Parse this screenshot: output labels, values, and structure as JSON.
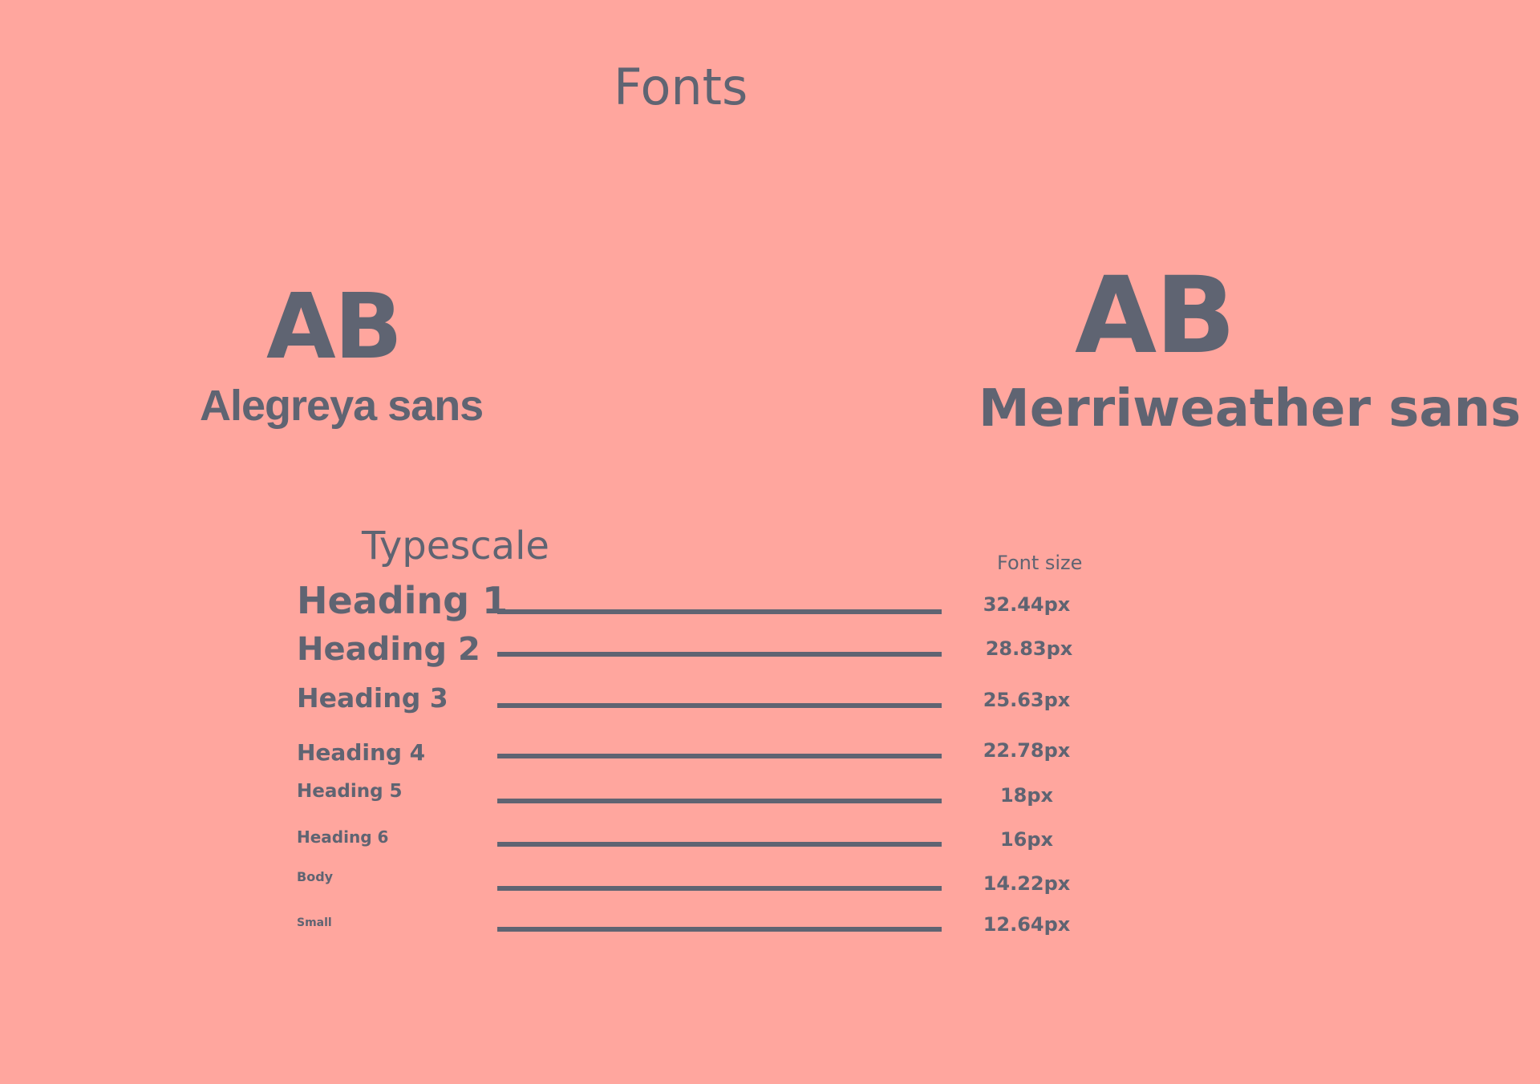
{
  "page": {
    "title": "Fonts"
  },
  "fonts": [
    {
      "sample": "AB",
      "name": "Alegreya sans"
    },
    {
      "sample": "AB",
      "name": "Merriweather sans"
    }
  ],
  "typescale": {
    "title": "Typescale",
    "size_header": "Font size",
    "rows": [
      {
        "label": "Heading 1",
        "size": "32.44px"
      },
      {
        "label": "Heading 2",
        "size": "28.83px"
      },
      {
        "label": "Heading 3",
        "size": "25.63px"
      },
      {
        "label": "Heading 4",
        "size": "22.78px"
      },
      {
        "label": "Heading 5",
        "size": "18px"
      },
      {
        "label": "Heading 6",
        "size": "16px"
      },
      {
        "label": "Body",
        "size": "14.22px"
      },
      {
        "label": "Small",
        "size": "12.64px"
      }
    ]
  },
  "colors": {
    "background": "#ffa69e",
    "text": "#5f6472"
  }
}
